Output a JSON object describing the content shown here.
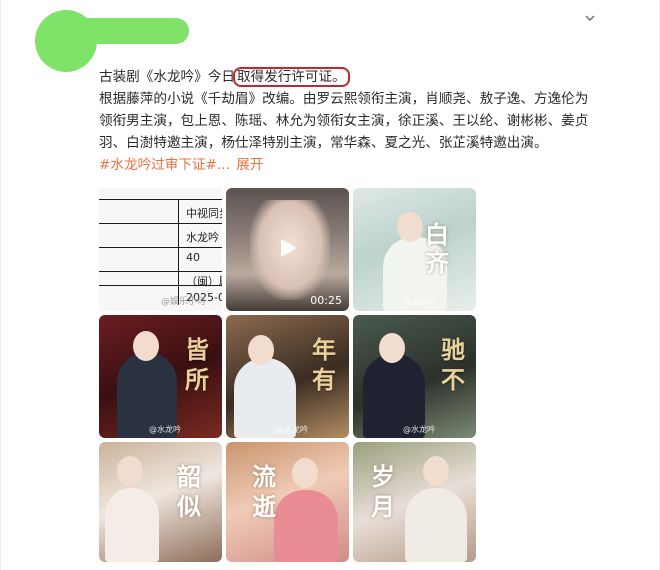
{
  "post": {
    "text_line1_prefix": "古装剧《水龙吟》今日",
    "text_line1_highlight": "取得发行许可证。",
    "text_line2": "根据藤萍的小说《千劫眉》改编。由罗云熙领衔主演，肖顺尧、敖子逸、方逸伦为",
    "text_line3": "领衔男主演，包上恩、陈瑶、林允为领衔女主演，徐正溪、王以纶、谢彬彬、姜贞",
    "text_line4": "羽、白澍特邀主演，杨仕泽特别主演，常华森、夏之光、张芷溪特邀出演。",
    "topic": "#水龙吟过审下证#",
    "ellipsis": "...",
    "expand_label": "展开",
    "more_icon": "chevron-down-icon",
    "highlight_color": "#c0292b",
    "topic_color": "#eb7340"
  },
  "media": {
    "doc": {
      "cells": [
        "中视同步",
        "水龙吟",
        "40",
        "（闽）剧",
        "2025-0"
      ],
      "watermark": "@娱乐小可"
    },
    "video": {
      "duration": "00:25",
      "play_icon": "play-icon"
    },
    "posters": [
      {
        "chars": [
          "白",
          "齐"
        ],
        "watermark": "@水龙吟"
      },
      {
        "chars": [
          "皆",
          "所"
        ],
        "watermark": "@水龙吟"
      },
      {
        "chars": [
          "年",
          "有"
        ],
        "watermark": "@水龙吟"
      },
      {
        "chars": [
          "驰",
          "不"
        ],
        "watermark": "@水龙吟"
      },
      {
        "chars": [
          "韶",
          "似"
        ],
        "watermark": ""
      },
      {
        "chars": [
          "流",
          "逝"
        ],
        "watermark": ""
      },
      {
        "chars": [
          "岁",
          "月"
        ],
        "watermark": ""
      }
    ]
  }
}
